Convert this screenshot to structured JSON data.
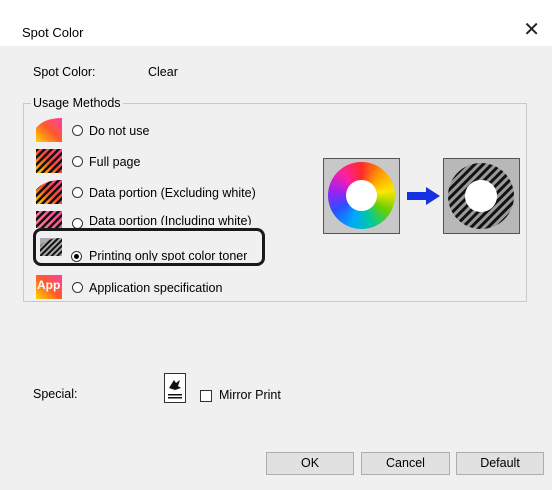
{
  "dialog": {
    "title": "Spot Color",
    "close_glyph": "✕"
  },
  "spot_color": {
    "label": "Spot Color:",
    "value": "Clear"
  },
  "usage": {
    "group_label": "Usage Methods",
    "options": [
      {
        "label": "Do not use",
        "selected": false,
        "icon": "gradient-icon"
      },
      {
        "label": "Full page",
        "selected": false,
        "icon": "striped-full-icon"
      },
      {
        "label": "Data portion (Excluding white)",
        "selected": false,
        "icon": "striped-data-icon"
      },
      {
        "label": "Data portion (Including white)",
        "selected": false,
        "icon": "striped-data-white-icon"
      },
      {
        "label": "Printing only spot color toner",
        "selected": true,
        "icon": "spot-toner-icon"
      },
      {
        "label": "Application specification",
        "selected": false,
        "icon": "app-spec-icon"
      }
    ],
    "app_icon_text": "App"
  },
  "special": {
    "label": "Special:",
    "mirror_label": "Mirror Print",
    "mirror_checked": false
  },
  "buttons": {
    "ok": "OK",
    "cancel": "Cancel",
    "default": "Default"
  }
}
